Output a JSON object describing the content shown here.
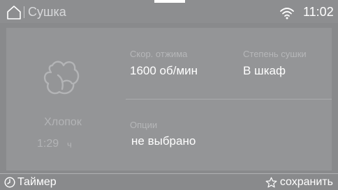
{
  "header": {
    "title": "Сушка",
    "time": "11:02",
    "home_icon": "home-icon",
    "wifi_icon": "wifi-icon"
  },
  "program": {
    "icon": "cotton-icon",
    "name": "Хлопок",
    "duration": "1:29",
    "duration_unit": "ч"
  },
  "settings": {
    "spin": {
      "label": "Скор. отжима",
      "value": "1600 об/мин"
    },
    "dryness": {
      "label": "Степень сушки",
      "value": "В шкаф"
    },
    "options": {
      "label": "Опции",
      "value": "не выбрано"
    }
  },
  "footer": {
    "timer_label": "Таймер",
    "timer_icon": "clock-icon",
    "save_label": "сохранить",
    "save_icon": "star-icon"
  },
  "colors": {
    "background": "#898a8c",
    "panel": "#949597",
    "text": "#ffffff",
    "muted_text": "#b6b7b9"
  }
}
